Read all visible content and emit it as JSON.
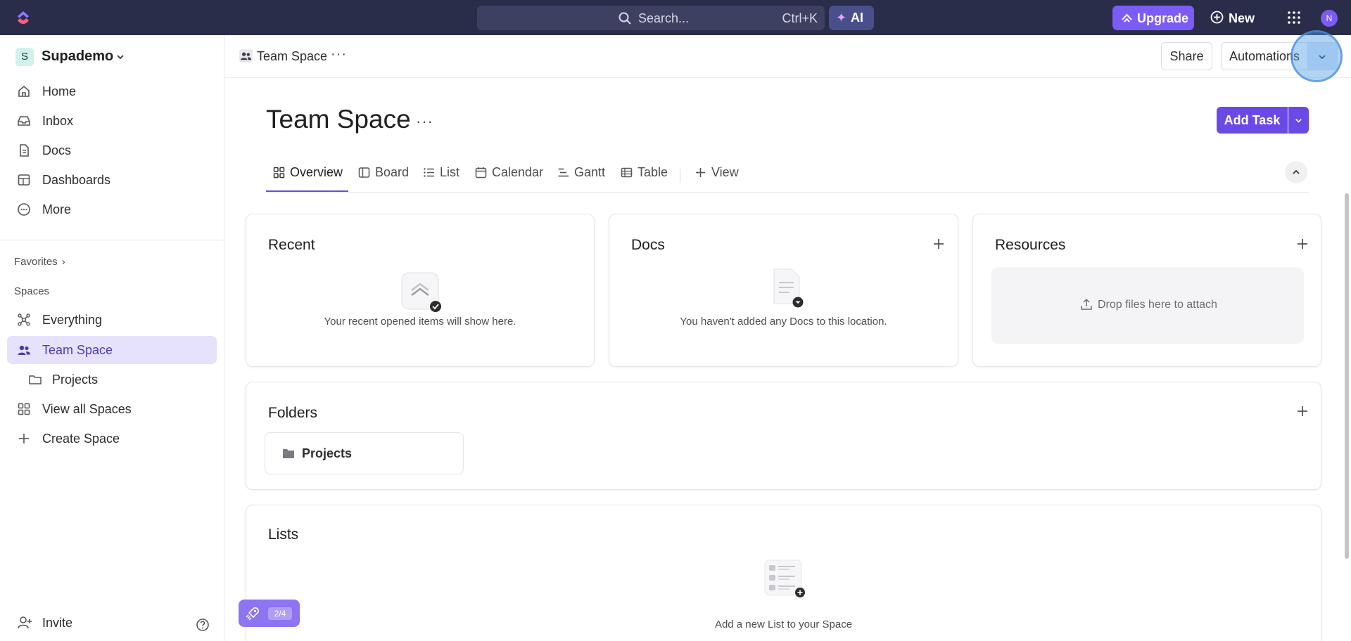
{
  "topbar": {
    "search_placeholder": "Search...",
    "search_shortcut": "Ctrl+K",
    "ai_label": "AI",
    "upgrade_label": "Upgrade",
    "new_label": "New",
    "user_initial": "N"
  },
  "sidebar": {
    "workspace_initial": "S",
    "workspace_name": "Supademo",
    "nav": [
      {
        "label": "Home",
        "icon": "home-icon"
      },
      {
        "label": "Inbox",
        "icon": "inbox-icon"
      },
      {
        "label": "Docs",
        "icon": "docs-icon"
      },
      {
        "label": "Dashboards",
        "icon": "dashboards-icon"
      },
      {
        "label": "More",
        "icon": "more-icon"
      }
    ],
    "favorites_label": "Favorites",
    "spaces_label": "Spaces",
    "spaces": [
      {
        "label": "Everything",
        "icon": "everything-icon"
      },
      {
        "label": "Team Space",
        "icon": "team-icon",
        "active": true
      },
      {
        "label": "Projects",
        "icon": "folder-icon",
        "sub": true
      },
      {
        "label": "View all Spaces",
        "icon": "grid-icon"
      },
      {
        "label": "Create Space",
        "icon": "plus-icon"
      }
    ],
    "invite_label": "Invite"
  },
  "header": {
    "breadcrumb": "Team Space",
    "share_label": "Share",
    "automations_label": "Automations"
  },
  "main": {
    "title": "Team Space",
    "add_task_label": "Add Task",
    "tabs": [
      {
        "label": "Overview",
        "icon": "overview-icon",
        "active": true
      },
      {
        "label": "Board",
        "icon": "board-icon"
      },
      {
        "label": "List",
        "icon": "list-icon"
      },
      {
        "label": "Calendar",
        "icon": "calendar-icon"
      },
      {
        "label": "Gantt",
        "icon": "gantt-icon"
      },
      {
        "label": "Table",
        "icon": "table-icon"
      },
      {
        "label": "View",
        "icon": "plus-icon"
      }
    ],
    "recent": {
      "title": "Recent",
      "empty": "Your recent opened items will show here."
    },
    "docs": {
      "title": "Docs",
      "empty": "You haven't added any Docs to this location."
    },
    "resources": {
      "title": "Resources",
      "drop": "Drop files here to attach"
    },
    "folders": {
      "title": "Folders",
      "items": [
        "Projects"
      ]
    },
    "lists": {
      "title": "Lists",
      "empty": "Add a new List to your Space"
    }
  },
  "onboarding": {
    "progress": "2/4"
  },
  "colors": {
    "accent": "#6a49e6",
    "topbar": "#2a2d4a",
    "upgrade": "#7b5cf6",
    "active_bg": "#e6e2fc"
  }
}
